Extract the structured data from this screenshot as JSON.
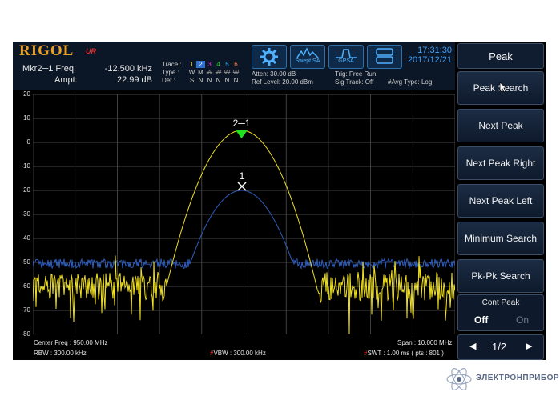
{
  "header": {
    "logo": "RIGOL",
    "logo_sub": "UR",
    "marker_freq_label": "Mkr2─1 Freq:",
    "marker_freq_value": "-12.500 kHz",
    "marker_ampt_label": "Ampt:",
    "marker_ampt_value": "22.99 dB",
    "trace_label": "Trace :",
    "trace_numbers": [
      "1",
      "2",
      "3",
      "4",
      "5",
      "6"
    ],
    "type_label": "Type :",
    "type_values": [
      "W",
      "M",
      "W",
      "W",
      "W",
      "W"
    ],
    "det_label": "Det :",
    "det_values": [
      "S",
      "N",
      "N",
      "N",
      "N",
      "N"
    ],
    "atten": "Atten: 30.00 dB",
    "ref_level": "Ref Level: 20.00 dBm",
    "trig": "Trig: Free Run",
    "sig_track": "Sig Track: Off",
    "avg_type": "#Avg Type: Log",
    "mode_buttons": [
      {
        "icon": "gear-icon",
        "label": ""
      },
      {
        "icon": "swept-sa-icon",
        "label": "Swept SA"
      },
      {
        "icon": "gpsa-icon",
        "label": "GPSA"
      },
      {
        "icon": "grid-icon",
        "label": ""
      }
    ],
    "time": "17:31:30",
    "date": "2017/12/21"
  },
  "plot": {
    "y_ticks": [
      "20",
      "10",
      "0",
      "-10",
      "-20",
      "-30",
      "-40",
      "-50",
      "-60",
      "-70",
      "-80"
    ],
    "marker_2_label": "2─1",
    "marker_1_label": "1",
    "colors": {
      "trace1": "#f0e020",
      "trace2": "#2f5fc0",
      "marker2": "#20e020",
      "grid": "#5a5a5a"
    }
  },
  "footer": {
    "center_freq": "Center Freq : 950.00 MHz",
    "span": "Span : 10.000 MHz",
    "rbw": "RBW : 300.00 kHz",
    "vbw_mark": "#",
    "vbw": "VBW : 300.00 kHz",
    "swt_mark": "#",
    "swt": "SWT : 1.00 ms ( pts : 801 )"
  },
  "softkeys": {
    "title": "Peak",
    "items": [
      "Peak Search",
      "Next Peak",
      "Next Peak Right",
      "Next Peak Left",
      "Minimum Search",
      "Pk-Pk Search"
    ],
    "cont_peak": {
      "label": "Cont Peak",
      "off": "Off",
      "on": "On"
    },
    "pager": "1/2"
  },
  "brand": {
    "text": "ЭЛЕКТРОНПРИБОР"
  }
}
